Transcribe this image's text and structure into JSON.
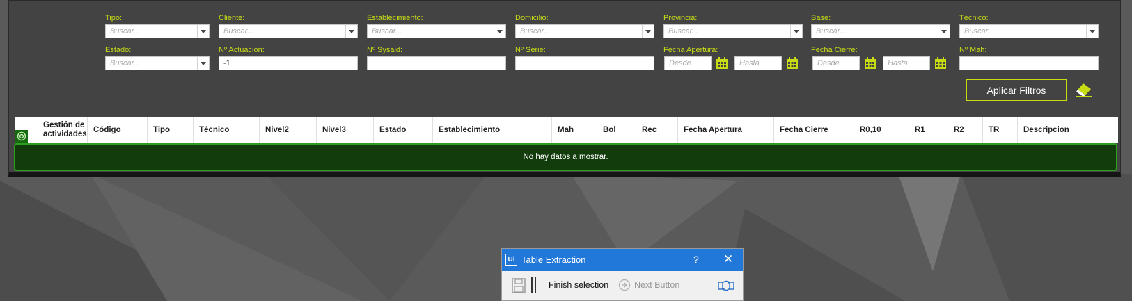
{
  "filters": {
    "tipo": {
      "label": "Tipo:",
      "placeholder": "Buscar..."
    },
    "cliente": {
      "label": "Cliente:",
      "placeholder": "Buscar..."
    },
    "establecimiento": {
      "label": "Establecimiento:",
      "placeholder": "Buscar..."
    },
    "domicilio": {
      "label": "Domicilio:",
      "placeholder": "Buscar..."
    },
    "provincia": {
      "label": "Provincia:",
      "placeholder": "Buscar..."
    },
    "base": {
      "label": "Base:",
      "placeholder": "Buscar..."
    },
    "tecnico": {
      "label": "Técnico:",
      "placeholder": "Buscar..."
    },
    "estado": {
      "label": "Estado:",
      "placeholder": "Buscar..."
    },
    "actuacion": {
      "label": "Nº Actuación:",
      "value": "-1"
    },
    "sysaid": {
      "label": "Nº Sysaid:",
      "value": ""
    },
    "serie": {
      "label": "Nº Serie:",
      "value": ""
    },
    "fecha_apertura": {
      "label": "Fecha Apertura:",
      "desde": "Desde",
      "hasta": "Hasta"
    },
    "fecha_cierre": {
      "label": "Fecha Cierre:",
      "desde": "Desde",
      "hasta": "Hasta"
    },
    "mah": {
      "label": "Nº Mah:",
      "value": ""
    }
  },
  "apply_label": "Aplicar Filtros",
  "table": {
    "columns": [
      "Gestión de actividades",
      "Código",
      "Tipo",
      "Técnico",
      "Nivel2",
      "Nivel3",
      "Estado",
      "Establecimiento",
      "Mah",
      "Bol",
      "Rec",
      "Fecha Apertura",
      "Fecha Cierre",
      "R0,10",
      "R1",
      "R2",
      "TR",
      "Descripcion"
    ],
    "empty_message": "No hay datos a mostrar."
  },
  "table_extraction": {
    "logo": "Ui",
    "title": "Table Extraction",
    "help": "?",
    "close": "✕",
    "finish_label": "Finish selection",
    "next_label": "Next Button"
  },
  "colors": {
    "accent": "#c8dc14",
    "panel": "#434343",
    "empty_row": "#123c0c",
    "dialog_title": "#2278d8"
  },
  "icons": [
    "calendar-icon",
    "eraser-icon",
    "gear-icon",
    "save-icon",
    "next-icon",
    "refresh-icon"
  ]
}
